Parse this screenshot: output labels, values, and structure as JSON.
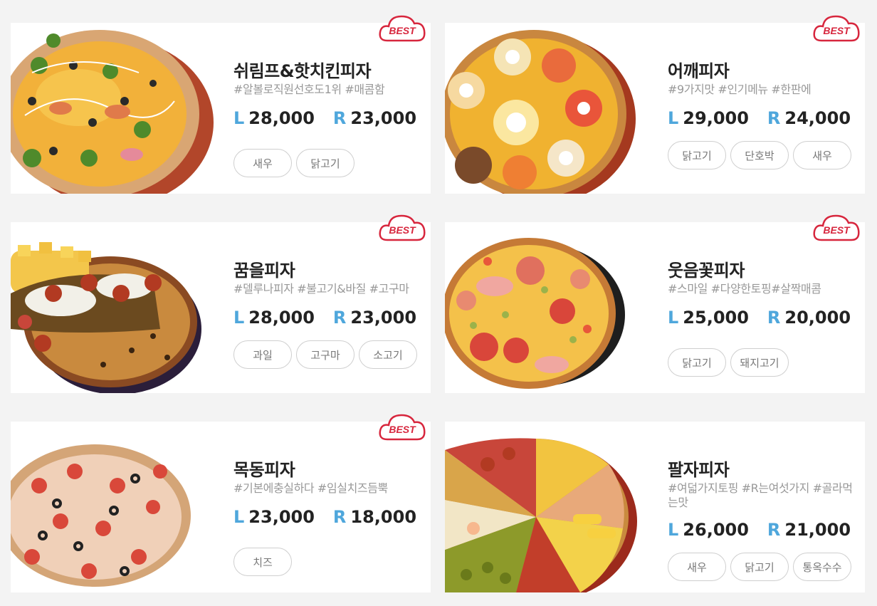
{
  "best_badge_label": "BEST",
  "colors": {
    "accent_blue": "#4fa7dc",
    "best_red": "#d7263d"
  },
  "menu": [
    {
      "name": "쉬림프&핫치킨피자",
      "tags": "#알볼로직원선호도1위 #매콤함",
      "large_label": "L",
      "large_price": "28,000",
      "regular_label": "R",
      "regular_price": "23,000",
      "options": [
        "새우",
        "닭고기"
      ]
    },
    {
      "name": "어깨피자",
      "tags": "#9가지맛 #인기메뉴 #한판에",
      "large_label": "L",
      "large_price": "29,000",
      "regular_label": "R",
      "regular_price": "24,000",
      "options": [
        "닭고기",
        "단호박",
        "새우"
      ]
    },
    {
      "name": "꿈을피자",
      "tags": "#델루나피자 #불고기&바질 #고구마",
      "large_label": "L",
      "large_price": "28,000",
      "regular_label": "R",
      "regular_price": "23,000",
      "options": [
        "과일",
        "고구마",
        "소고기"
      ]
    },
    {
      "name": "웃음꽃피자",
      "tags": "#스마일 #다양한토핑#살짝매콤",
      "large_label": "L",
      "large_price": "25,000",
      "regular_label": "R",
      "regular_price": "20,000",
      "options": [
        "닭고기",
        "돼지고기"
      ]
    },
    {
      "name": "목동피자",
      "tags": "#기본에충실하다 #임실치즈듬뿍",
      "large_label": "L",
      "large_price": "23,000",
      "regular_label": "R",
      "regular_price": "18,000",
      "options": [
        "치즈"
      ]
    },
    {
      "name": "팔자피자",
      "tags": "#여덟가지토핑 #R는여섯가지 #골라먹는맛",
      "large_label": "L",
      "large_price": "26,000",
      "regular_label": "R",
      "regular_price": "21,000",
      "options": [
        "새우",
        "닭고기",
        "통옥수수"
      ]
    }
  ]
}
